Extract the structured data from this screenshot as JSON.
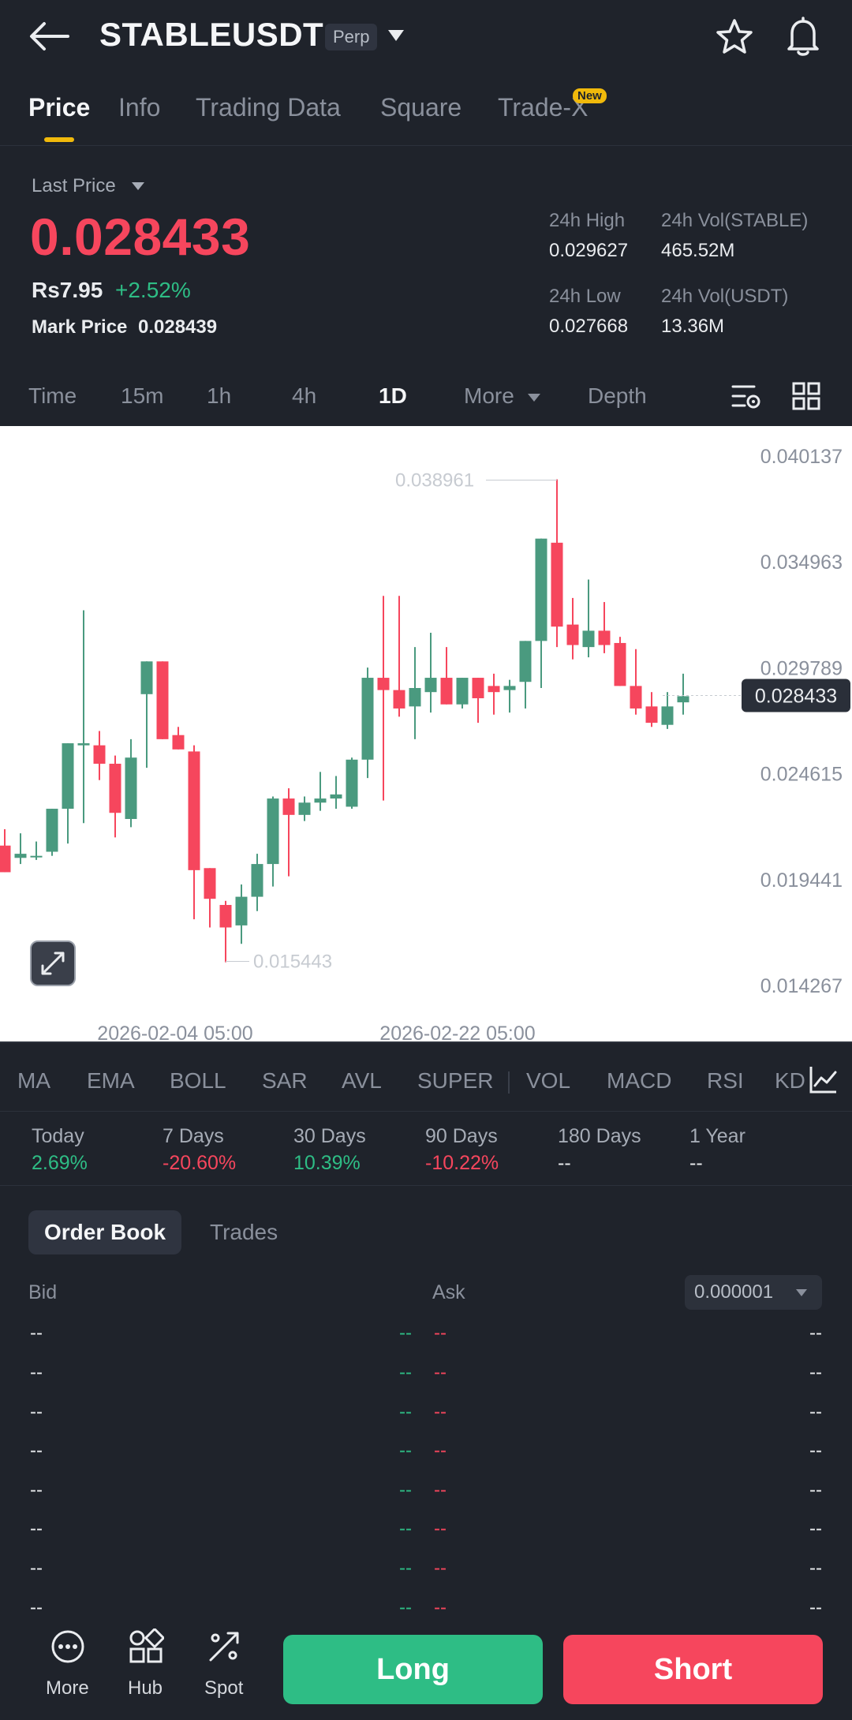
{
  "header": {
    "symbol": "STABLEUSDT",
    "contract_badge": "Perp",
    "tabs": [
      {
        "label": "Price"
      },
      {
        "label": "Info"
      },
      {
        "label": "Trading Data"
      },
      {
        "label": "Square"
      },
      {
        "label": "Trade-X"
      }
    ],
    "new_badge": "New"
  },
  "price": {
    "last_price_label": "Last Price",
    "last_price": "0.028433",
    "local_price": "Rs7.95",
    "change_pct": "+2.52%",
    "mark_price_label": "Mark Price",
    "mark_price": "0.028439",
    "stats": {
      "high_label": "24h High",
      "high": "0.029627",
      "vol_base_label": "24h Vol(STABLE)",
      "vol_base": "465.52M",
      "low_label": "24h Low",
      "low": "0.027668",
      "vol_quote_label": "24h Vol(USDT)",
      "vol_quote": "13.36M"
    }
  },
  "timeframes": {
    "items": [
      "Time",
      "15m",
      "1h",
      "4h",
      "1D",
      "More",
      "Depth"
    ],
    "active": "1D"
  },
  "colors": {
    "up": "#2ebd85",
    "chart_up": "#4a9a7f",
    "down": "#f6465d",
    "accent": "#f0b90b",
    "background": "#1f232b"
  },
  "chart_data": {
    "type": "candlestick",
    "y_ticks": [
      "0.040137",
      "0.034963",
      "0.029789",
      "0.024615",
      "0.019441",
      "0.014267"
    ],
    "ylim": [
      0.0123,
      0.0416
    ],
    "x_ticks": [
      "2026-02-04 05:00",
      "2026-02-22 05:00"
    ],
    "high_marker": "0.038961",
    "low_marker": "0.015443",
    "current_price_label": "0.028433",
    "candles": [
      {
        "o": 0.0211,
        "h": 0.0219,
        "l": 0.0201,
        "c": 0.0198
      },
      {
        "o": 0.0205,
        "h": 0.0217,
        "l": 0.0202,
        "c": 0.0207
      },
      {
        "o": 0.0206,
        "h": 0.0213,
        "l": 0.0204,
        "c": 0.0206
      },
      {
        "o": 0.0208,
        "h": 0.0215,
        "l": 0.0206,
        "c": 0.0229
      },
      {
        "o": 0.0229,
        "h": 0.0261,
        "l": 0.0212,
        "c": 0.0261
      },
      {
        "o": 0.026,
        "h": 0.0326,
        "l": 0.0222,
        "c": 0.0261
      },
      {
        "o": 0.026,
        "h": 0.0267,
        "l": 0.0243,
        "c": 0.0251
      },
      {
        "o": 0.0251,
        "h": 0.0255,
        "l": 0.0215,
        "c": 0.0227
      },
      {
        "o": 0.0224,
        "h": 0.0263,
        "l": 0.022,
        "c": 0.0254
      },
      {
        "o": 0.0285,
        "h": 0.0298,
        "l": 0.0249,
        "c": 0.0301
      },
      {
        "o": 0.0301,
        "h": 0.0295,
        "l": 0.0264,
        "c": 0.0263
      },
      {
        "o": 0.0265,
        "h": 0.0269,
        "l": 0.0259,
        "c": 0.0258
      },
      {
        "o": 0.0257,
        "h": 0.026,
        "l": 0.0175,
        "c": 0.0199
      },
      {
        "o": 0.02,
        "h": 0.0199,
        "l": 0.0171,
        "c": 0.0185
      },
      {
        "o": 0.0182,
        "h": 0.0184,
        "l": 0.0154,
        "c": 0.0171
      },
      {
        "o": 0.0172,
        "h": 0.0192,
        "l": 0.0163,
        "c": 0.0186
      },
      {
        "o": 0.0186,
        "h": 0.0207,
        "l": 0.0179,
        "c": 0.0202
      },
      {
        "o": 0.0202,
        "h": 0.0235,
        "l": 0.0191,
        "c": 0.0234
      },
      {
        "o": 0.0234,
        "h": 0.0239,
        "l": 0.0196,
        "c": 0.0226
      },
      {
        "o": 0.0226,
        "h": 0.0235,
        "l": 0.0223,
        "c": 0.0232
      },
      {
        "o": 0.0232,
        "h": 0.0247,
        "l": 0.0228,
        "c": 0.0234
      },
      {
        "o": 0.0234,
        "h": 0.0245,
        "l": 0.0229,
        "c": 0.0236
      },
      {
        "o": 0.023,
        "h": 0.0254,
        "l": 0.0229,
        "c": 0.0253
      },
      {
        "o": 0.0253,
        "h": 0.0298,
        "l": 0.0244,
        "c": 0.0293
      },
      {
        "o": 0.0293,
        "h": 0.0333,
        "l": 0.0233,
        "c": 0.0287
      },
      {
        "o": 0.0287,
        "h": 0.0333,
        "l": 0.0274,
        "c": 0.0278
      },
      {
        "o": 0.0279,
        "h": 0.0308,
        "l": 0.0263,
        "c": 0.0288
      },
      {
        "o": 0.0286,
        "h": 0.0315,
        "l": 0.0276,
        "c": 0.0293
      },
      {
        "o": 0.0293,
        "h": 0.0308,
        "l": 0.0282,
        "c": 0.028
      },
      {
        "o": 0.028,
        "h": 0.0293,
        "l": 0.0278,
        "c": 0.0293
      },
      {
        "o": 0.0293,
        "h": 0.0293,
        "l": 0.0271,
        "c": 0.0283
      },
      {
        "o": 0.0289,
        "h": 0.0295,
        "l": 0.0275,
        "c": 0.0286
      },
      {
        "o": 0.0287,
        "h": 0.0292,
        "l": 0.0276,
        "c": 0.0289
      },
      {
        "o": 0.0291,
        "h": 0.0303,
        "l": 0.0278,
        "c": 0.0311
      },
      {
        "o": 0.0311,
        "h": 0.0346,
        "l": 0.0288,
        "c": 0.0361
      },
      {
        "o": 0.0359,
        "h": 0.039,
        "l": 0.0308,
        "c": 0.0318
      },
      {
        "o": 0.0319,
        "h": 0.0332,
        "l": 0.0302,
        "c": 0.0309
      },
      {
        "o": 0.0308,
        "h": 0.0341,
        "l": 0.0303,
        "c": 0.0316
      },
      {
        "o": 0.0316,
        "h": 0.033,
        "l": 0.0305,
        "c": 0.0309
      },
      {
        "o": 0.031,
        "h": 0.0313,
        "l": 0.0289,
        "c": 0.0289
      },
      {
        "o": 0.0289,
        "h": 0.0307,
        "l": 0.0275,
        "c": 0.0278
      },
      {
        "o": 0.0279,
        "h": 0.0286,
        "l": 0.0269,
        "c": 0.0271
      },
      {
        "o": 0.027,
        "h": 0.0286,
        "l": 0.0268,
        "c": 0.0279
      },
      {
        "o": 0.0281,
        "h": 0.0295,
        "l": 0.0275,
        "c": 0.0284
      }
    ]
  },
  "indicators": [
    "MA",
    "EMA",
    "BOLL",
    "SAR",
    "AVL",
    "SUPER",
    "VOL",
    "MACD",
    "RSI",
    "KD"
  ],
  "performance": [
    {
      "label": "Today",
      "value": "2.69%",
      "dir": "up"
    },
    {
      "label": "7 Days",
      "value": "-20.60%",
      "dir": "down"
    },
    {
      "label": "30 Days",
      "value": "10.39%",
      "dir": "up"
    },
    {
      "label": "90 Days",
      "value": "-10.22%",
      "dir": "down"
    },
    {
      "label": "180 Days",
      "value": "--",
      "dir": "none"
    },
    {
      "label": "1 Year",
      "value": "--",
      "dir": "none"
    }
  ],
  "order_book": {
    "tabs": [
      "Order Book",
      "Trades"
    ],
    "bid_label": "Bid",
    "ask_label": "Ask",
    "precision": "0.000001",
    "rows": [
      {
        "bid_qty": "--",
        "bid_price": "--",
        "ask_price": "--",
        "ask_qty": "--"
      },
      {
        "bid_qty": "--",
        "bid_price": "--",
        "ask_price": "--",
        "ask_qty": "--"
      },
      {
        "bid_qty": "--",
        "bid_price": "--",
        "ask_price": "--",
        "ask_qty": "--"
      },
      {
        "bid_qty": "--",
        "bid_price": "--",
        "ask_price": "--",
        "ask_qty": "--"
      },
      {
        "bid_qty": "--",
        "bid_price": "--",
        "ask_price": "--",
        "ask_qty": "--"
      },
      {
        "bid_qty": "--",
        "bid_price": "--",
        "ask_price": "--",
        "ask_qty": "--"
      },
      {
        "bid_qty": "--",
        "bid_price": "--",
        "ask_price": "--",
        "ask_qty": "--"
      },
      {
        "bid_qty": "--",
        "bid_price": "--",
        "ask_price": "--",
        "ask_qty": "--"
      }
    ]
  },
  "bottom_bar": {
    "more_label": "More",
    "hub_label": "Hub",
    "spot_label": "Spot",
    "long_label": "Long",
    "short_label": "Short"
  }
}
